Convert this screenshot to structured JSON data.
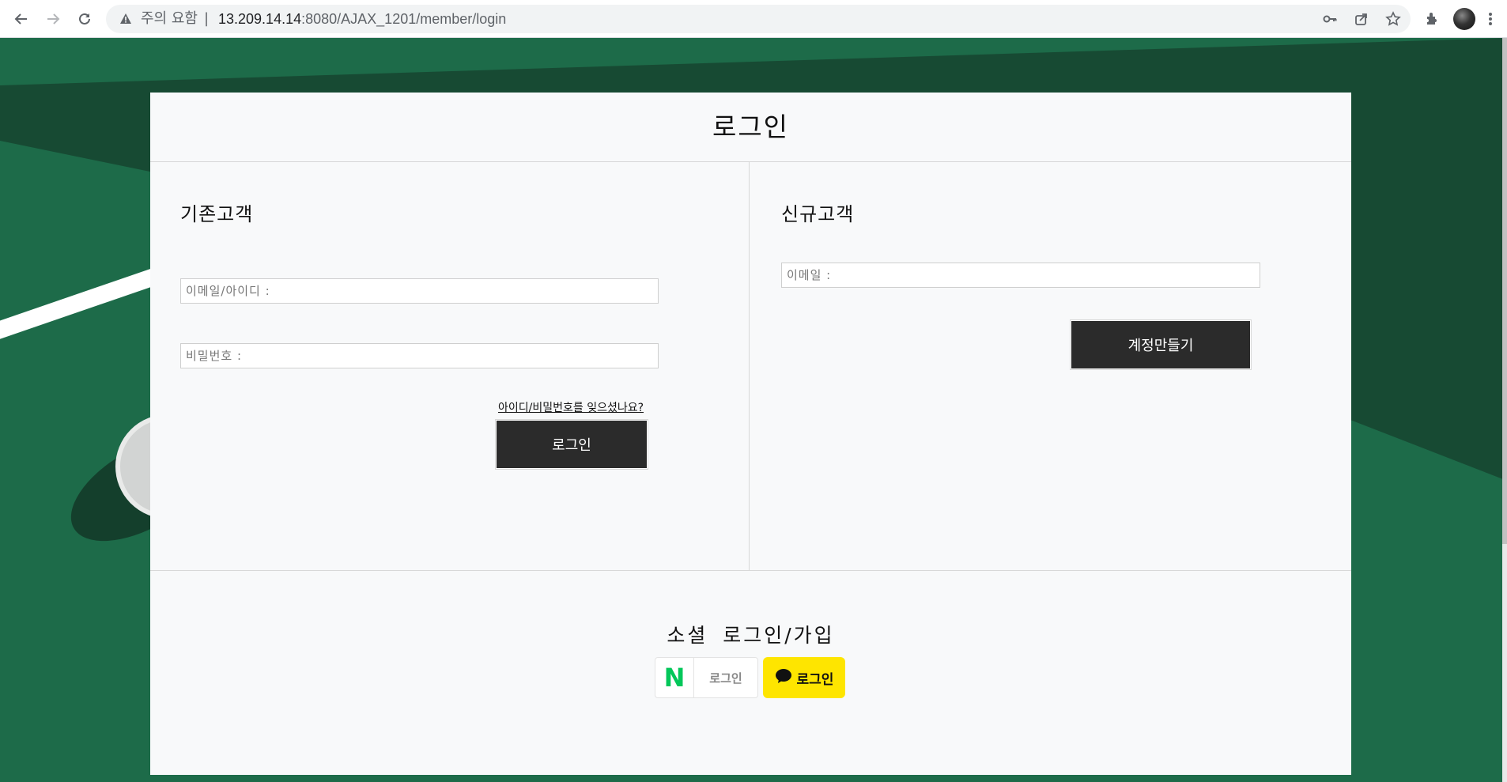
{
  "browser": {
    "security_label": "주의 요함",
    "separator": "|",
    "url_host": "13.209.14.14",
    "url_path": ":8080/AJAX_1201/member/login",
    "icons": [
      "back-arrow-icon",
      "forward-arrow-icon",
      "reload-icon",
      "warning-icon",
      "key-icon",
      "share-icon",
      "star-icon",
      "extensions-icon",
      "avatar",
      "menu-dots-icon"
    ]
  },
  "page": {
    "title": "로그인",
    "existing": {
      "heading": "기존고객",
      "id_placeholder": "이메일/아이디 :",
      "password_placeholder": "비밀번호 :",
      "forgot_link": "아이디/비밀번호를 잊으셨나요?",
      "login_button": "로그인"
    },
    "new": {
      "heading": "신규고객",
      "email_placeholder": "이메일 :",
      "create_button": "계정만들기"
    },
    "social": {
      "heading": "소셜 로그인/가입",
      "naver_logo": "N",
      "naver_label": "로그인",
      "kakao_label": "로그인"
    }
  },
  "colors": {
    "background_green": "#1d6b49",
    "background_dark_green": "#174a33",
    "button_dark": "#2b2b2b",
    "naver_green": "#03c75a",
    "kakao_yellow": "#fee500"
  }
}
